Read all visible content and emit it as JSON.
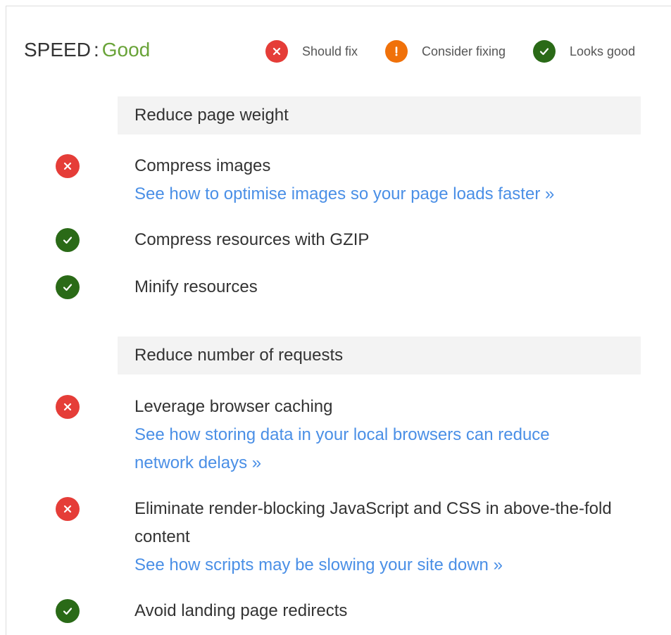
{
  "header": {
    "label": "SPEED",
    "separator": ":",
    "status": "Good",
    "status_color": "#69a338"
  },
  "legend": [
    {
      "icon": "x-icon",
      "label": "Should fix",
      "color": "#e53d38"
    },
    {
      "icon": "exclamation-icon",
      "label": "Consider fixing",
      "color": "#f0710a"
    },
    {
      "icon": "check-icon",
      "label": "Looks good",
      "color": "#2a6a17"
    }
  ],
  "sections": [
    {
      "title": "Reduce page weight",
      "items": [
        {
          "status": "should-fix",
          "text": "Compress images",
          "link": "See how to optimise images so your page loads faster »"
        },
        {
          "status": "looks-good",
          "text": "Compress resources with GZIP"
        },
        {
          "status": "looks-good",
          "text": "Minify resources"
        }
      ]
    },
    {
      "title": "Reduce number of requests",
      "items": [
        {
          "status": "should-fix",
          "text": "Leverage browser caching",
          "link": "See how storing data in your local browsers can reduce network delays »"
        },
        {
          "status": "should-fix",
          "text": "Eliminate render-blocking JavaScript and CSS in above-the-fold content",
          "link": "See how scripts may be slowing your site down »"
        },
        {
          "status": "looks-good",
          "text": "Avoid landing page redirects"
        }
      ]
    }
  ]
}
